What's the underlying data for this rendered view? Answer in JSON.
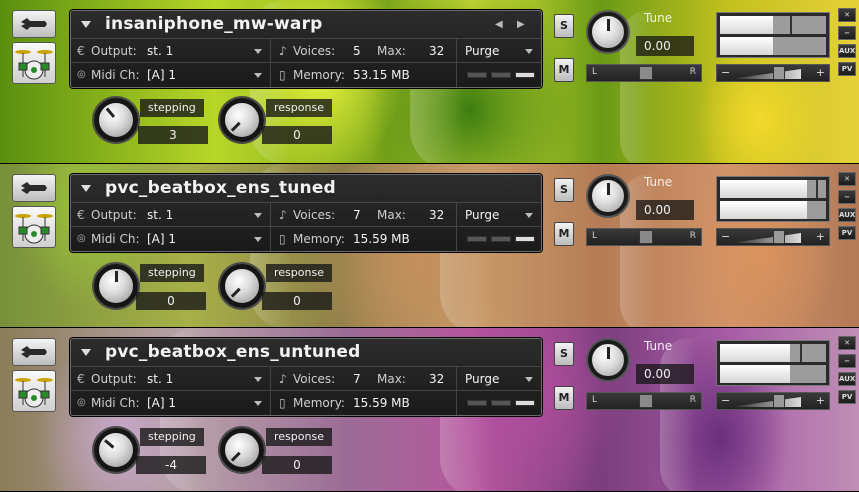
{
  "instruments": [
    {
      "name": "insaniphone_mw-warp",
      "output_label": "Output:",
      "output_value": "st. 1",
      "voices_label": "Voices:",
      "voices_value": "5",
      "max_label": "Max:",
      "max_value": "32",
      "purge_label": "Purge",
      "midi_label": "Midi Ch:",
      "midi_value": "[A]  1",
      "memory_label": "Memory:",
      "memory_value": "53.15 MB",
      "solo_label": "S",
      "mute_label": "M",
      "tune_label": "Tune",
      "tune_value": "0.00",
      "pan_left": "L",
      "pan_right": "R",
      "vol_minus": "−",
      "vol_plus": "+",
      "side_close": "✕",
      "side_min": "−",
      "side_aux": "AUX",
      "side_pv": "PV",
      "vu_level_1": 0.5,
      "vu_level_2": 0.5,
      "knobs": [
        {
          "label": "stepping",
          "value": "3"
        },
        {
          "label": "response",
          "value": "0"
        }
      ]
    },
    {
      "name": "pvc_beatbox_ens_tuned",
      "output_label": "Output:",
      "output_value": "st. 1",
      "voices_label": "Voices:",
      "voices_value": "7",
      "max_label": "Max:",
      "max_value": "32",
      "purge_label": "Purge",
      "midi_label": "Midi Ch:",
      "midi_value": "[A]  1",
      "memory_label": "Memory:",
      "memory_value": "15.59 MB",
      "solo_label": "S",
      "mute_label": "M",
      "tune_label": "Tune",
      "tune_value": "0.00",
      "pan_left": "L",
      "pan_right": "R",
      "vol_minus": "−",
      "vol_plus": "+",
      "side_close": "✕",
      "side_min": "−",
      "side_aux": "AUX",
      "side_pv": "PV",
      "vu_level_1": 0.82,
      "vu_level_2": 0.82,
      "knobs": [
        {
          "label": "stepping",
          "value": "0"
        },
        {
          "label": "response",
          "value": "0"
        }
      ]
    },
    {
      "name": "pvc_beatbox_ens_untuned",
      "output_label": "Output:",
      "output_value": "st. 1",
      "voices_label": "Voices:",
      "voices_value": "7",
      "max_label": "Max:",
      "max_value": "32",
      "purge_label": "Purge",
      "midi_label": "Midi Ch:",
      "midi_value": "[A]  1",
      "memory_label": "Memory:",
      "memory_value": "15.59 MB",
      "solo_label": "S",
      "mute_label": "M",
      "tune_label": "Tune",
      "tune_value": "0.00",
      "pan_left": "L",
      "pan_right": "R",
      "vol_minus": "−",
      "vol_plus": "+",
      "side_close": "✕",
      "side_min": "−",
      "side_aux": "AUX",
      "side_pv": "PV",
      "vu_level_1": 0.66,
      "vu_level_2": 0.66,
      "knobs": [
        {
          "label": "stepping",
          "value": "-4"
        },
        {
          "label": "response",
          "value": "0"
        }
      ]
    }
  ]
}
